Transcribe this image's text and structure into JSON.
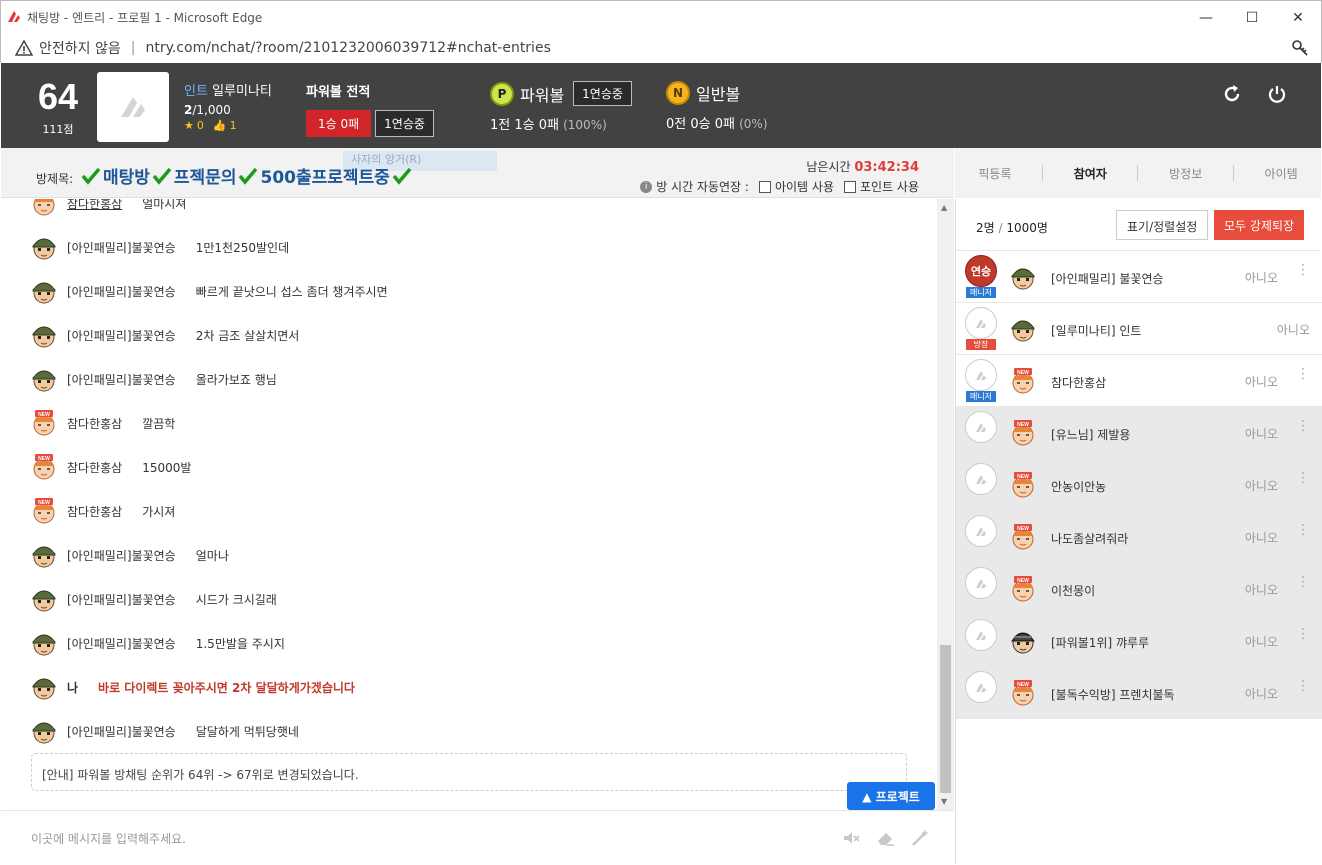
{
  "window": {
    "title": "채팅방 - 엔트리 - 프로필 1 - Microsoft Edge",
    "minimize": "—",
    "maximize": "☐",
    "close": "✕"
  },
  "address": {
    "security": "안전하지 않음",
    "separator": "|",
    "url": "ntry.com/nchat/?room/2101232006039712#nchat-entries"
  },
  "header": {
    "level": "64",
    "points": "111점",
    "user": {
      "tag": "인트",
      "name": "일루미나티",
      "count_cur": "2",
      "count_max": "/1,000",
      "stars": "0",
      "likes": "1"
    },
    "powerball_record": {
      "label": "파워볼 전적",
      "result": "1승 0패",
      "streak": "1연승중"
    },
    "powerball": {
      "coin": "P",
      "name": "파워볼",
      "streak": "1연승중",
      "record": "1전 1승 0패",
      "pct": "(100%)"
    },
    "normalball": {
      "coin": "N",
      "name": "일반볼",
      "record": "0전 0승 0패",
      "pct": "(0%)"
    }
  },
  "room": {
    "label": "방제목:",
    "title_parts": [
      "매탕방",
      "프젝문의",
      "500출프로젝트중"
    ],
    "ghost": "사자의 앙거(R)",
    "remaining_label": "남은시간",
    "remaining_time": "03:42:34",
    "info": "i",
    "opt_label": "방 시간 자동연장 :",
    "opt_item": "아이템 사용",
    "opt_point": "포인트 사용"
  },
  "tabs": [
    "픽등록",
    "참여자",
    "방정보",
    "아이템"
  ],
  "chat": {
    "messages": [
      {
        "who": "참다한홍삼",
        "text": "얼마시져",
        "type": "new"
      },
      {
        "who": "[아인패밀리]불꽃연승",
        "text": "1만1천250발인데",
        "type": "soldier"
      },
      {
        "who": "[아인패밀리]불꽃연승",
        "text": "빠르게 끝낫으니 섭스 좀더 챙겨주시면",
        "type": "soldier"
      },
      {
        "who": "[아인패밀리]불꽃연승",
        "text": "2차 금조 살살치면서",
        "type": "soldier"
      },
      {
        "who": "[아인패밀리]불꽃연승",
        "text": "올라가보죠 행님",
        "type": "soldier"
      },
      {
        "who": "참다한홍삼",
        "text": "깔끔학",
        "type": "new"
      },
      {
        "who": "참다한홍삼",
        "text": "15000발",
        "type": "new"
      },
      {
        "who": "참다한홍삼",
        "text": "가시져",
        "type": "new"
      },
      {
        "who": "[아인패밀리]불꽃연승",
        "text": "얼마나",
        "type": "soldier"
      },
      {
        "who": "[아인패밀리]불꽃연승",
        "text": "시드가 크시길래",
        "type": "soldier"
      },
      {
        "who": "[아인패밀리]불꽃연승",
        "text": "1.5만발을 주시지",
        "type": "soldier"
      },
      {
        "who": "나",
        "text": "바로 다이렉트 꽂아주시면 2차 달달하게가겠습니다",
        "type": "me"
      },
      {
        "who": "[아인패밀리]불꽃연승",
        "text": "달달하게 먹튀당햇네",
        "type": "soldier"
      }
    ],
    "notice": "[안내] 파워볼 방채팅 순위가 64위 -> 67위로 변경되었습니다.",
    "project_button": "▲ 프로젝트",
    "placeholder": "이곳에 메시지를 입력해주세요."
  },
  "participants": {
    "count": "2명",
    "max": "1000명",
    "display_button": "표기/정렬설정",
    "kick_button": "모두 강제퇴장",
    "rows": [
      {
        "name": "[아인패밀리] 불꽃연승",
        "status": "아니오",
        "badge": "연승",
        "role": "매니저",
        "avatar": "soldier",
        "gray": false,
        "menu": true
      },
      {
        "name": "[일루미나티] 인트",
        "status": "아니오",
        "badge": "",
        "role": "방장",
        "avatar": "soldier",
        "gray": false,
        "menu": false
      },
      {
        "name": "참다한홍삼",
        "status": "아니오",
        "badge": "",
        "role": "매니저",
        "avatar": "new",
        "gray": false,
        "menu": true
      },
      {
        "name": "[유느님] 제발용",
        "status": "아니오",
        "badge": "",
        "role": "",
        "avatar": "new",
        "gray": true,
        "menu": true
      },
      {
        "name": "안농이안농",
        "status": "아니오",
        "badge": "",
        "role": "",
        "avatar": "new",
        "gray": true,
        "menu": true
      },
      {
        "name": "나도좀살려줘라",
        "status": "아니오",
        "badge": "",
        "role": "",
        "avatar": "new",
        "gray": true,
        "menu": true
      },
      {
        "name": "이천몽이",
        "status": "아니오",
        "badge": "",
        "role": "",
        "avatar": "new",
        "gray": true,
        "menu": true
      },
      {
        "name": "[파워볼1위] 꺄루루",
        "status": "아니오",
        "badge": "",
        "role": "",
        "avatar": "dark",
        "gray": true,
        "menu": true
      },
      {
        "name": "[불독수익방] 프렌치불독",
        "status": "아니오",
        "badge": "",
        "role": "",
        "avatar": "new",
        "gray": true,
        "menu": true
      }
    ]
  },
  "colors": {
    "header_bg": "#424242",
    "accent_red": "#e74c3c",
    "title_blue": "#1e5799",
    "timer_red": "#e23b3b",
    "project_blue": "#1a73e8"
  }
}
